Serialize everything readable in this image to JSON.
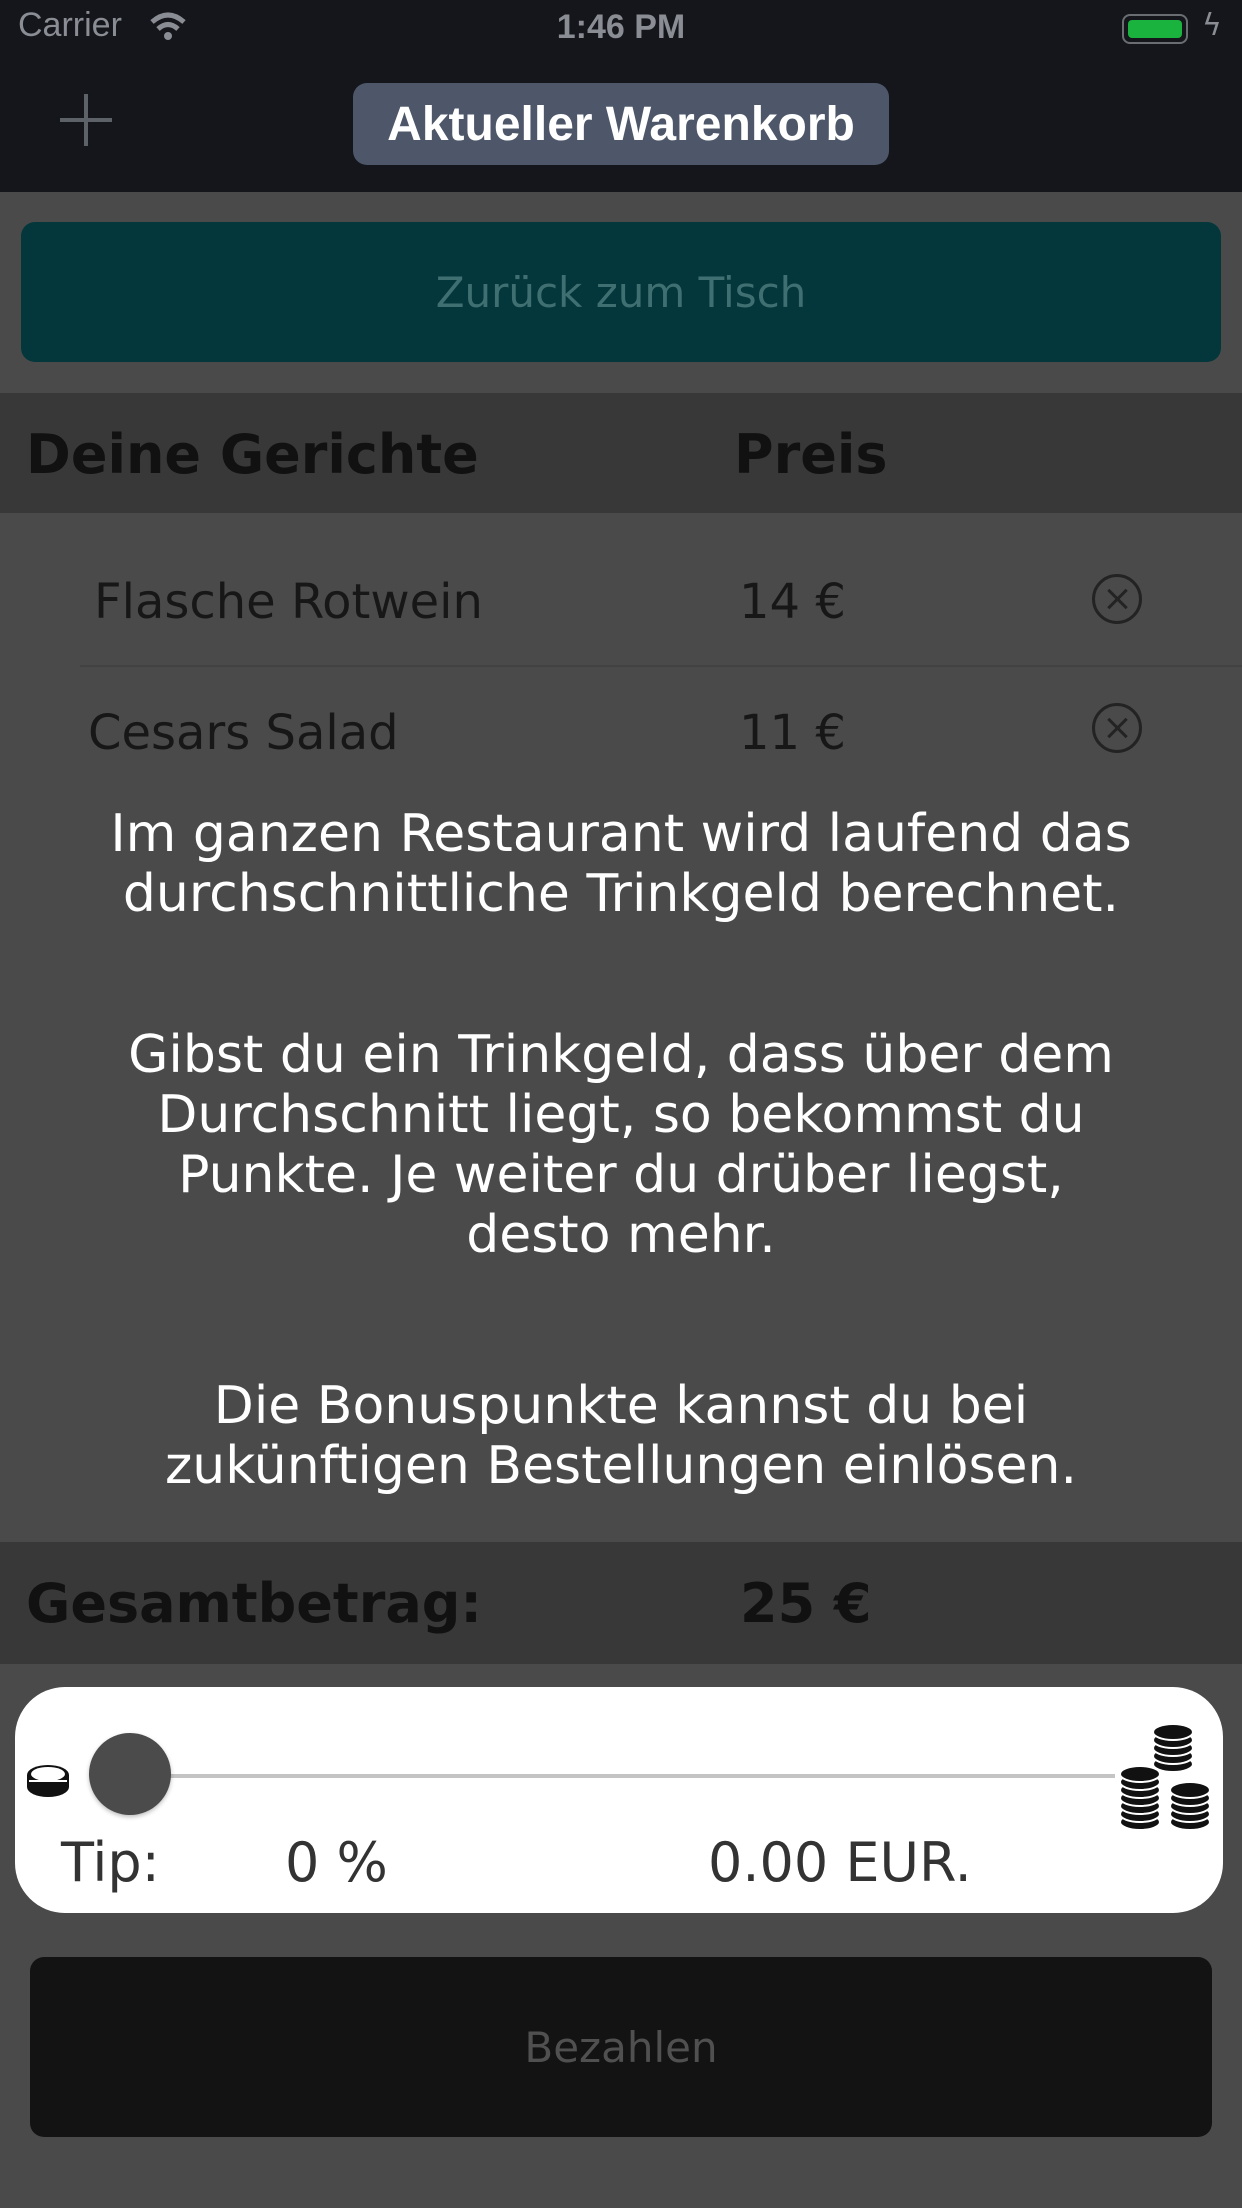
{
  "status_bar": {
    "carrier": "Carrier",
    "time": "1:46 PM"
  },
  "nav": {
    "title": "Aktueller Warenkorb"
  },
  "back_button": {
    "label": "Zurück zum Tisch"
  },
  "table_header": {
    "dishes": "Deine Gerichte",
    "price": "Preis"
  },
  "items": [
    {
      "name": "Flasche Rotwein",
      "price": "14 €"
    },
    {
      "name": "Cesars Salad",
      "price": "11 €"
    }
  ],
  "info_text": {
    "p1_line1": "Im ganzen Restaurant wird laufend das",
    "p1_line2": "durchschnittliche Trinkgeld berechnet.",
    "p2_line1": "Gibst du ein Trinkgeld, dass über dem",
    "p2_line2": "Durchschnitt liegt, so bekommst du",
    "p2_line3": "Punkte. Je weiter du drüber liegst,",
    "p2_line4": "desto mehr.",
    "p3_line1": "Die Bonuspunkte kannst du bei",
    "p3_line2": "zukünftigen Bestellungen einlösen."
  },
  "total": {
    "label": "Gesamtbetrag:",
    "value": "25 €"
  },
  "tip": {
    "label": "Tip:",
    "percent": "0 %",
    "amount": "0.00 EUR.",
    "slider_value": 0
  },
  "pay_button": {
    "label": "Bezahlen"
  },
  "colors": {
    "back_button_bg": "#04373b",
    "nav_title_bg": "#4d5769",
    "battery": "#19b33d"
  }
}
